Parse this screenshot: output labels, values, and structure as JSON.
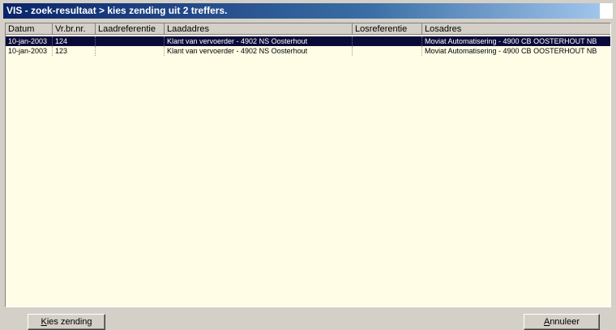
{
  "window": {
    "title": "VIS - zoek-resultaat > kies zending uit 2 treffers."
  },
  "table": {
    "columns": [
      "Datum",
      "Vr.br.nr.",
      "Laadreferentie",
      "Laadadres",
      "Losreferentie",
      "Losadres"
    ],
    "rows": [
      {
        "datum": "10-jan-2003",
        "vrbrnr": "124",
        "laadreferentie": "",
        "laadadres": "Klant van vervoerder - 4902 NS Oosterhout",
        "losreferentie": "",
        "losadres": "Moviat Automatisering - 4900 CB OOSTERHOUT NB",
        "selected": true
      },
      {
        "datum": "10-jan-2003",
        "vrbrnr": "123",
        "laadreferentie": "",
        "laadadres": "Klant van vervoerder - 4902 NS Oosterhout",
        "losreferentie": "",
        "losadres": "Moviat Automatisering - 4900 CB OOSTERHOUT NB",
        "selected": false
      }
    ]
  },
  "buttons": {
    "choose_first": "K",
    "choose_rest": "ies zending",
    "cancel_first": "A",
    "cancel_rest": "nnuleer"
  },
  "colors": {
    "title_bar": "#0a246a",
    "list_background": "#fffde6",
    "selected_row": "#0a0a3a",
    "window_face": "#d4d0c8"
  }
}
